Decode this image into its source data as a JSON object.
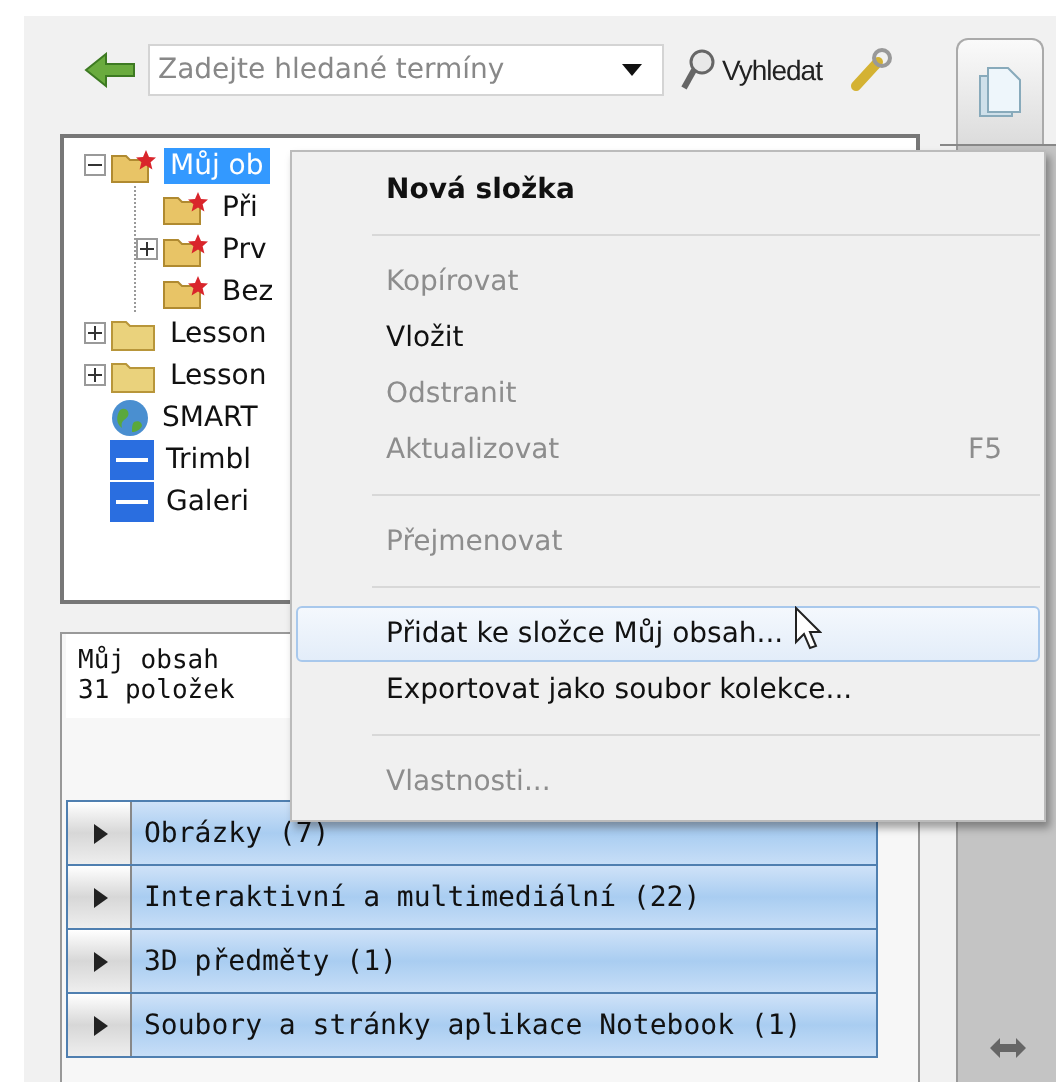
{
  "search": {
    "placeholder": "Zadejte hledané termíny",
    "button": "Vyhledat"
  },
  "tree": [
    {
      "label": "Můj ob",
      "kind": "star-folder",
      "selected": true,
      "expanded": true,
      "children": [
        {
          "label": "Při",
          "kind": "star-folder",
          "selected": false
        },
        {
          "label": "Prv",
          "kind": "star-folder",
          "selected": false,
          "expanded": false
        },
        {
          "label": "Bez",
          "kind": "star-folder",
          "selected": false
        }
      ]
    },
    {
      "label": "Lesson",
      "kind": "folder",
      "selected": false,
      "expanded": false
    },
    {
      "label": "Lesson",
      "kind": "folder",
      "selected": false,
      "expanded": false
    },
    {
      "label": "SMART",
      "kind": "globe",
      "selected": false
    },
    {
      "label": "Trimbl",
      "kind": "gallery",
      "selected": false
    },
    {
      "label": "Galeri",
      "kind": "gallery",
      "selected": false
    }
  ],
  "info": {
    "title": "Můj obsah",
    "count": "31 položek"
  },
  "categories": [
    {
      "label": "Obrázky (7)",
      "expanded": false
    },
    {
      "label": "Interaktivní a multimediální (22)",
      "expanded": false
    },
    {
      "label": "3D předměty (1)",
      "expanded": false
    },
    {
      "label": "Soubory a stránky aplikace Notebook (1)",
      "expanded": false
    }
  ],
  "context_menu": [
    {
      "kind": "item",
      "label": "Nová složka",
      "default": true,
      "disabled": false,
      "selected": false
    },
    {
      "kind": "separator"
    },
    {
      "kind": "item",
      "label": "Kopírovat",
      "default": false,
      "disabled": true,
      "selected": false
    },
    {
      "kind": "item",
      "label": "Vložit",
      "default": false,
      "disabled": false,
      "selected": false
    },
    {
      "kind": "item",
      "label": "Odstranit",
      "default": false,
      "disabled": true,
      "selected": false
    },
    {
      "kind": "item",
      "label": "Aktualizovat",
      "default": false,
      "disabled": true,
      "selected": false,
      "shortcut": "F5"
    },
    {
      "kind": "separator"
    },
    {
      "kind": "item",
      "label": "Přejmenovat",
      "default": false,
      "disabled": true,
      "selected": false
    },
    {
      "kind": "separator"
    },
    {
      "kind": "item",
      "label": "Přidat ke složce Můj obsah...",
      "default": false,
      "disabled": false,
      "selected": true
    },
    {
      "kind": "item",
      "label": "Exportovat jako soubor kolekce...",
      "default": false,
      "disabled": false,
      "selected": false
    },
    {
      "kind": "separator"
    },
    {
      "kind": "item",
      "label": "Vlastnosti...",
      "default": false,
      "disabled": true,
      "selected": false
    }
  ]
}
